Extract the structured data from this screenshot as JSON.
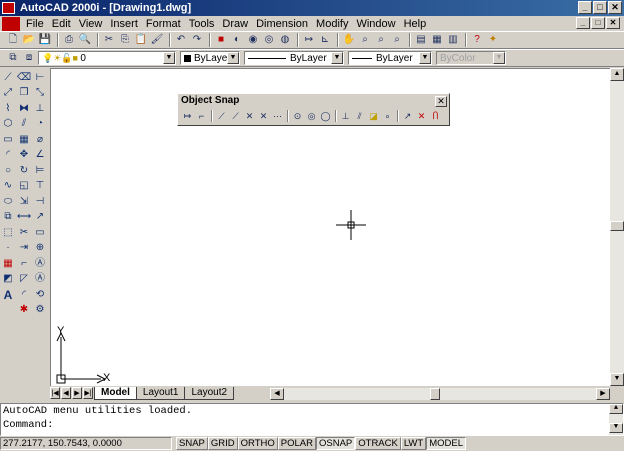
{
  "window": {
    "title": "AutoCAD 2000i - [Drawing1.dwg]"
  },
  "window_buttons": [
    "_",
    "□",
    "✕"
  ],
  "mdi_buttons": [
    "_",
    "□",
    "✕"
  ],
  "menu": [
    "File",
    "Edit",
    "View",
    "Insert",
    "Format",
    "Tools",
    "Draw",
    "Dimension",
    "Modify",
    "Window",
    "Help"
  ],
  "properties": {
    "layer": "0",
    "color": "ByLayer",
    "linetype": "ByLayer",
    "lineweight": "ByLayer",
    "plotstyle": "ByColor"
  },
  "osnap": {
    "title": "Object Snap",
    "close": "✕"
  },
  "ucs": {
    "x_label": "X",
    "y_label": "Y"
  },
  "tabs": {
    "model": "Model",
    "layout1": "Layout1",
    "layout2": "Layout2"
  },
  "nav": [
    "|◀",
    "◀",
    "▶",
    "▶|"
  ],
  "command": {
    "line1": "AutoCAD menu utilities loaded.",
    "line2": "Command:"
  },
  "status": {
    "coords": "277.2177, 150.7543, 0.0000",
    "toggles": [
      "SNAP",
      "GRID",
      "ORTHO",
      "POLAR",
      "OSNAP",
      "OTRACK",
      "LWT",
      "MODEL"
    ]
  }
}
